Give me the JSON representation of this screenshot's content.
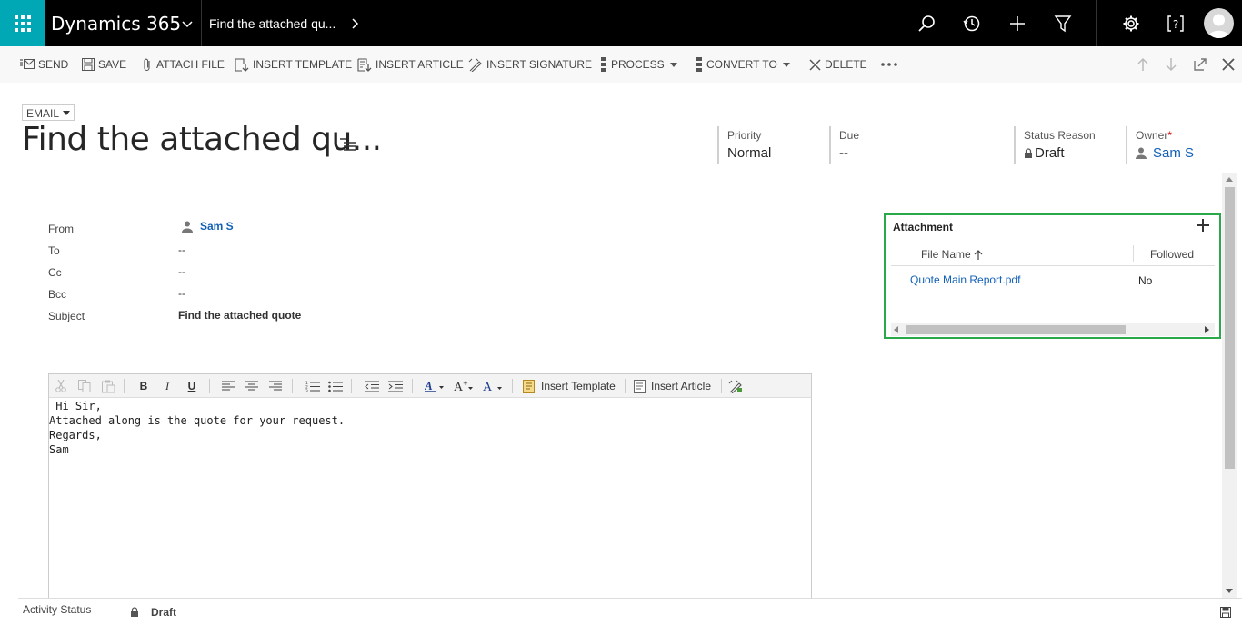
{
  "topbar": {
    "app_name": "Dynamics 365",
    "breadcrumb": "Find the attached qu...",
    "icons": [
      "app-launcher-icon",
      "chevron-down-icon",
      "chevron-right-icon",
      "search-icon",
      "history-icon",
      "plus-icon",
      "filter-icon",
      "settings-icon",
      "help-icon",
      "user-avatar"
    ],
    "accent_color": "#00a7b5"
  },
  "commands": {
    "send": "SEND",
    "save": "SAVE",
    "attach_file": "ATTACH FILE",
    "insert_template": "INSERT TEMPLATE",
    "insert_article": "INSERT ARTICLE",
    "insert_signature": "INSERT SIGNATURE",
    "process": "PROCESS",
    "convert_to": "CONVERT TO",
    "delete": "DELETE"
  },
  "header": {
    "entity_type": "EMAIL",
    "title": "Find the attached qu...",
    "priority_label": "Priority",
    "priority_value": "Normal",
    "due_label": "Due",
    "due_value": "--",
    "status_reason_label": "Status Reason",
    "status_reason_value": "Draft",
    "owner_label": "Owner",
    "owner_required": "*",
    "owner_value": "Sam S"
  },
  "form": {
    "from_label": "From",
    "from_value": "Sam S",
    "to_label": "To",
    "to_value": "--",
    "cc_label": "Cc",
    "cc_value": "--",
    "bcc_label": "Bcc",
    "bcc_value": "--",
    "subject_label": "Subject",
    "subject_value": "Find the attached quote"
  },
  "editor": {
    "toolbar": {
      "bold": "B",
      "italic": "I",
      "underline": "U",
      "insert_template": "Insert Template",
      "insert_article": "Insert Article"
    },
    "body_lines": [
      " Hi Sir,",
      "",
      "Attached along is the quote for your request.",
      "",
      "Regards,",
      "Sam"
    ]
  },
  "attachment": {
    "title": "Attachment",
    "columns": [
      "File Name",
      "Followed"
    ],
    "rows": [
      {
        "file_name": "Quote Main Report.pdf",
        "followed": "No"
      }
    ],
    "highlight_color": "#2aa84a"
  },
  "footer": {
    "label": "Activity Status",
    "value": "Draft"
  }
}
